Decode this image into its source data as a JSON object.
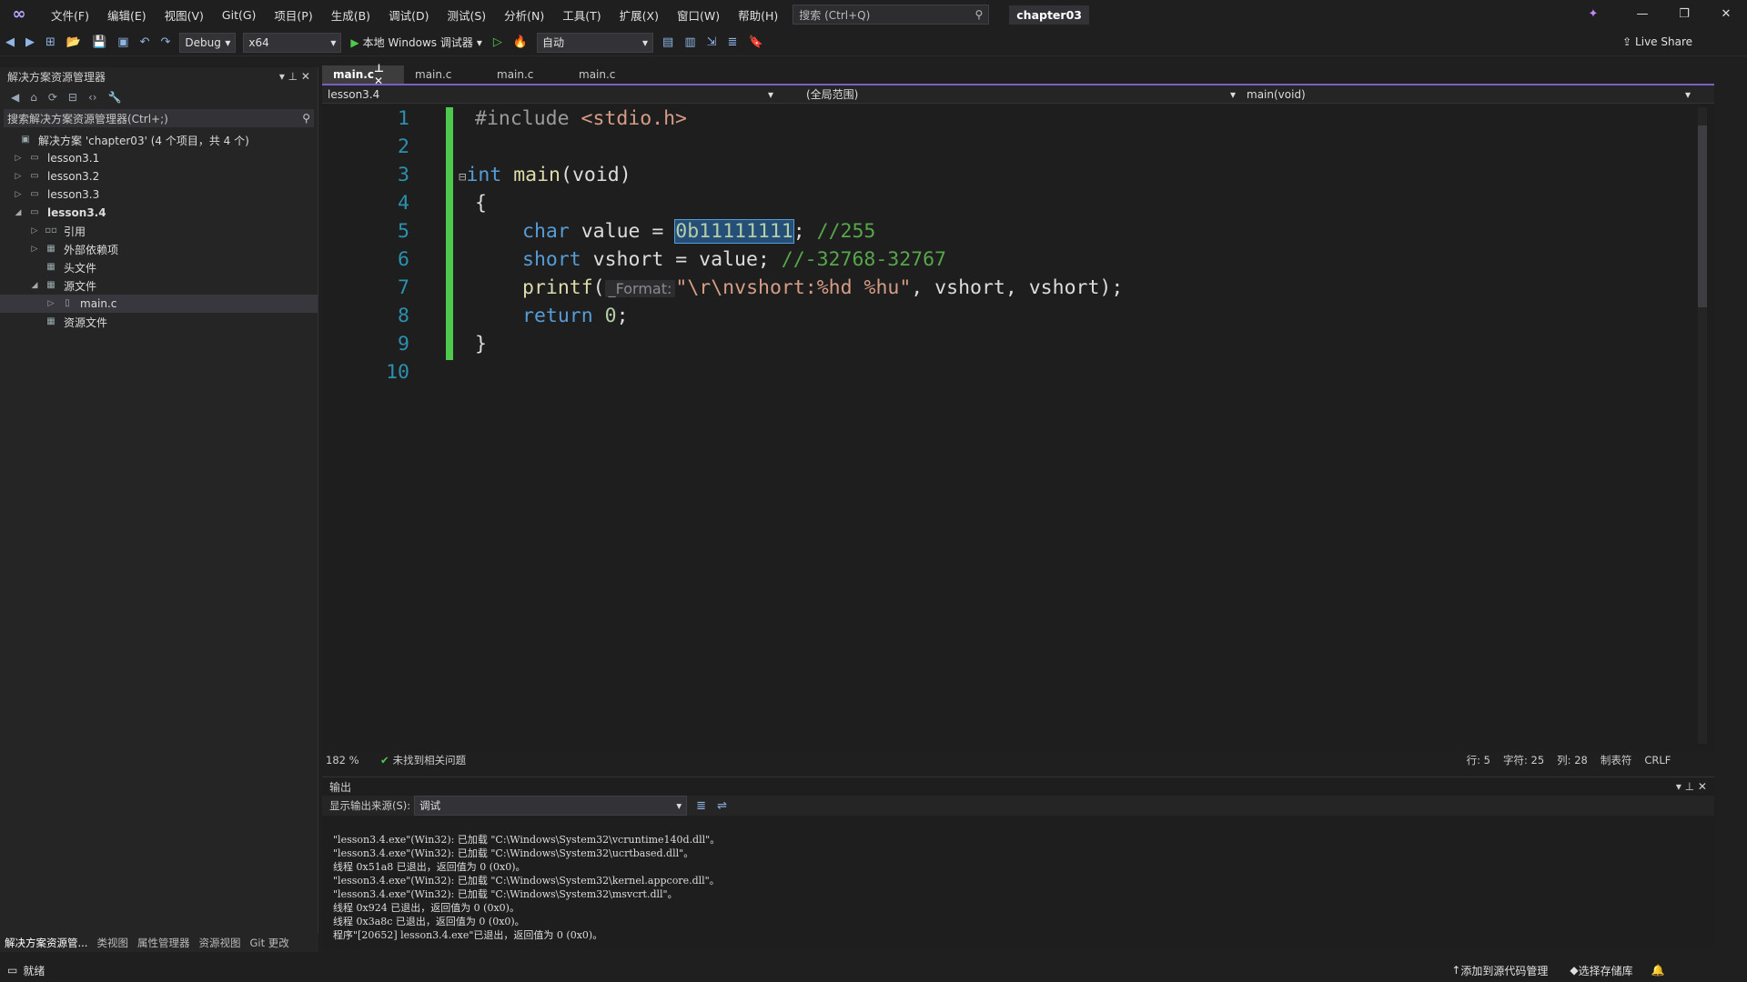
{
  "menu": [
    "文件(F)",
    "编辑(E)",
    "视图(V)",
    "Git(G)",
    "项目(P)",
    "生成(B)",
    "调试(D)",
    "测试(S)",
    "分析(N)",
    "工具(T)",
    "扩展(X)",
    "窗口(W)",
    "帮助(H)"
  ],
  "search_placeholder": "搜索 (Ctrl+Q)",
  "solution_title": "chapter03",
  "toolbar": {
    "config": "Debug",
    "platform": "x64",
    "run_label": "本地 Windows 调试器",
    "auto": "自动",
    "live_share": "Live Share"
  },
  "solution_explorer": {
    "title": "解决方案资源管理器",
    "search": "搜索解决方案资源管理器(Ctrl+;)",
    "items": [
      "解决方案 'chapter03' (4 个项目，共 4 个)",
      "lesson3.1",
      "lesson3.2",
      "lesson3.3",
      "lesson3.4",
      "引用",
      "外部依赖项",
      "头文件",
      "源文件",
      "main.c",
      "资源文件"
    ]
  },
  "bottom_tabs": [
    "解决方案资源管...",
    "类视图",
    "属性管理器",
    "资源视图",
    "Git 更改"
  ],
  "editor": {
    "tabs": [
      "main.c",
      "main.c",
      "main.c",
      "main.c"
    ],
    "nav_project": "lesson3.4",
    "nav_scope": "(全局范围)",
    "nav_func": "main(void)",
    "line_numbers": [
      "1",
      "2",
      "3",
      "4",
      "5",
      "6",
      "7",
      "8",
      "9",
      "10"
    ],
    "zoom": "182 %",
    "issues": "未找到相关问题",
    "cursor_row": "行: 5",
    "cursor_char": "字符: 25",
    "cursor_col": "列: 28",
    "indent": "制表符",
    "eol": "CRLF"
  },
  "code": {
    "l1a": "#include ",
    "l1b": "<stdio.h>",
    "l3a": "int ",
    "l3b": "main",
    "l3c": "(void)",
    "l4": "{",
    "l5a": "char ",
    "l5b": "value = ",
    "l5c": "0b11111111",
    "l5d": "; ",
    "l5e": "//255",
    "l6a": "short ",
    "l6b": "vshort = value; ",
    "l6c": "//-32768-32767",
    "l7a": "printf",
    "l7b": "(",
    "l7c": "_Format:",
    "l7d": "\"\\r\\nvshort:%hd %hu\"",
    "l7e": ", vshort, vshort);",
    "l8a": "return ",
    "l8b": "0",
    ";": ";",
    "l9": "}"
  },
  "output": {
    "title": "输出",
    "source_label": "显示输出来源(S):",
    "source_value": "调试",
    "lines": [
      "\"lesson3.4.exe\"(Win32): 已加载 \"C:\\Windows\\System32\\vcruntime140d.dll\"。",
      "\"lesson3.4.exe\"(Win32): 已加载 \"C:\\Windows\\System32\\ucrtbased.dll\"。",
      "线程 0x51a8 已退出，返回值为 0 (0x0)。",
      "\"lesson3.4.exe\"(Win32): 已加载 \"C:\\Windows\\System32\\kernel.appcore.dll\"。",
      "\"lesson3.4.exe\"(Win32): 已加载 \"C:\\Windows\\System32\\msvcrt.dll\"。",
      "线程 0x924 已退出，返回值为 0 (0x0)。",
      "线程 0x3a8c 已退出，返回值为 0 (0x0)。",
      "程序\"[20652] lesson3.4.exe\"已退出，返回值为 0 (0x0)。"
    ]
  },
  "status": {
    "ready": "就绪",
    "source_control": "添加到源代码管理",
    "repo": "选择存储库"
  }
}
